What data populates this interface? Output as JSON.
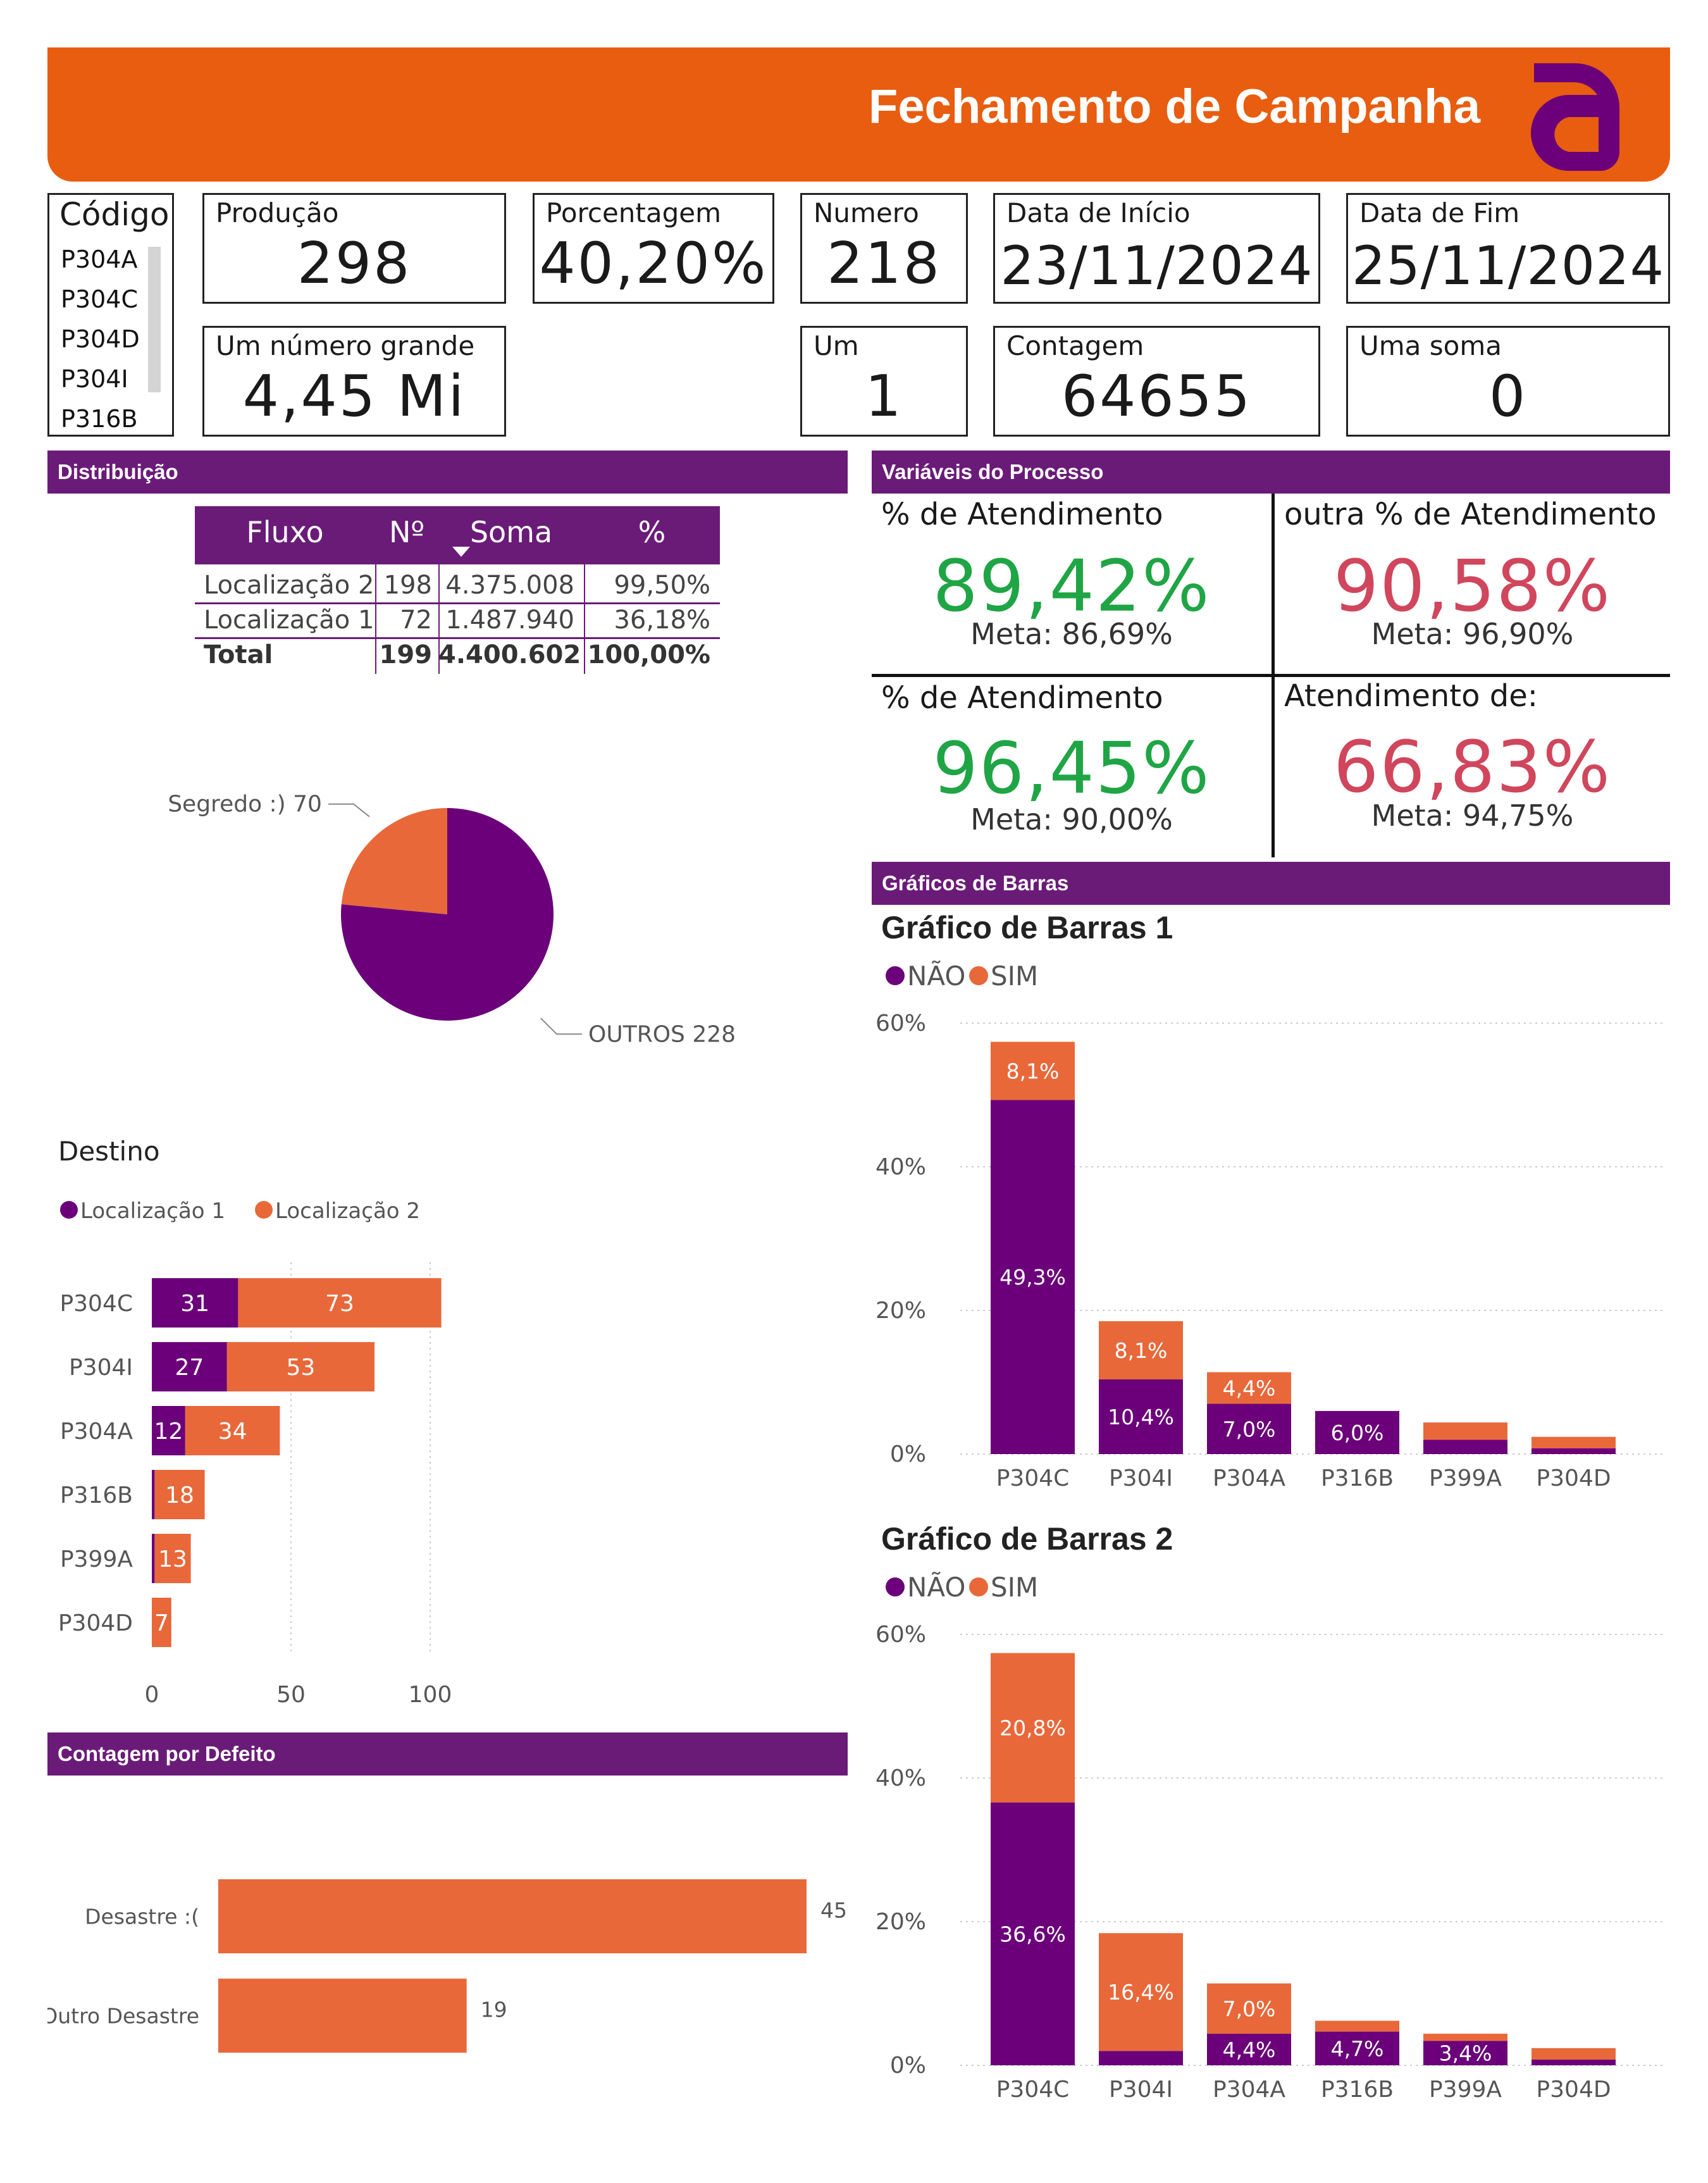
{
  "header": {
    "title": "Fechamento de Campanha"
  },
  "colors": {
    "purple": "#6b007a",
    "orange": "#e8683a",
    "header_orange": "#e85d10",
    "green": "#1fa545",
    "red": "#d0465c",
    "section": "#6a1b78"
  },
  "codigo": {
    "label": "Código",
    "items": [
      "P304A",
      "P304C",
      "P304D",
      "P304I",
      "P316B"
    ]
  },
  "cards": {
    "producao": {
      "label": "Produção",
      "value": "298"
    },
    "porcentagem": {
      "label": "Porcentagem",
      "value": "40,20%"
    },
    "numero": {
      "label": "Numero",
      "value": "218"
    },
    "data_inicio": {
      "label": "Data de Início",
      "value": "23/11/2024"
    },
    "data_fim": {
      "label": "Data de Fim",
      "value": "25/11/2024"
    },
    "numero_grande": {
      "label": "Um número grande",
      "value": "4,45 Mi"
    },
    "um": {
      "label": "Um",
      "value": "1"
    },
    "contagem": {
      "label": "Contagem",
      "value": "64655"
    },
    "soma": {
      "label": "Uma soma",
      "value": "0"
    }
  },
  "sections": {
    "distribuicao": "Distribuição",
    "variaveis": "Variáveis do Processo",
    "graficos": "Gráficos de Barras",
    "contagem_defeito": "Contagem por Defeito"
  },
  "table": {
    "headers": [
      "Fluxo",
      "Nº",
      "Soma",
      "%"
    ],
    "rows": [
      [
        "Localização 2",
        "198",
        "4.375.008",
        "99,50%"
      ],
      [
        "Localização 1",
        "72",
        "1.487.940",
        "36,18%"
      ]
    ],
    "total": [
      "Total",
      "199",
      "4.400.602",
      "100,00%"
    ]
  },
  "kpis": [
    {
      "label": "% de Atendimento",
      "value": "89,42%",
      "meta": "Meta: 86,69%",
      "status": "green"
    },
    {
      "label": "outra % de Atendimento",
      "value": "90,58%",
      "meta": "Meta: 96,90%",
      "status": "red"
    },
    {
      "label": "% de Atendimento",
      "value": "96,45%",
      "meta": "Meta: 90,00%",
      "status": "green"
    },
    {
      "label": "Atendimento de:",
      "value": "66,83%",
      "meta": "Meta: 94,75%",
      "status": "red"
    }
  ],
  "chart_data": [
    {
      "type": "pie",
      "title": "",
      "slices": [
        {
          "name": "OUTROS",
          "value": 228,
          "label": "OUTROS 228",
          "color": "#6b007a"
        },
        {
          "name": "Segredo :)",
          "value": 70,
          "label": "Segredo :) 70",
          "color": "#e8683a"
        }
      ]
    },
    {
      "type": "bar",
      "orientation": "horizontal",
      "stacked": true,
      "title": "Destino",
      "categories": [
        "P304C",
        "P304I",
        "P304A",
        "P316B",
        "P399A",
        "P304D"
      ],
      "series": [
        {
          "name": "Localização 1",
          "values": [
            31,
            27,
            12,
            1,
            1,
            0
          ],
          "labels": [
            "31",
            "27",
            "12",
            "",
            "",
            ""
          ],
          "color": "#6b007a"
        },
        {
          "name": "Localização 2",
          "values": [
            73,
            53,
            34,
            18,
            13,
            7
          ],
          "labels": [
            "73",
            "53",
            "34",
            "18",
            "13",
            "7"
          ],
          "color": "#e8683a"
        }
      ],
      "xticks": [
        "0",
        "50",
        "100"
      ],
      "xlim": [
        0,
        120
      ],
      "grid": true
    },
    {
      "type": "bar",
      "stacked": true,
      "title": "Gráfico de Barras 1",
      "categories": [
        "P304C",
        "P304I",
        "P304A",
        "P316B",
        "P399A",
        "P304D"
      ],
      "series": [
        {
          "name": "NÃO",
          "values": [
            49.3,
            10.4,
            7.0,
            6.0,
            2.0,
            0.8
          ],
          "labels": [
            "49,3%",
            "10,4%",
            "7,0%",
            "6,0%",
            "",
            ""
          ],
          "color": "#6b007a"
        },
        {
          "name": "SIM",
          "values": [
            8.1,
            8.1,
            4.4,
            0.0,
            2.4,
            1.6
          ],
          "labels": [
            "8,1%",
            "8,1%",
            "4,4%",
            "",
            "",
            ""
          ],
          "color": "#e8683a"
        }
      ],
      "yticks": [
        "0%",
        "20%",
        "40%",
        "60%"
      ],
      "ylim": [
        0,
        60
      ],
      "grid": true,
      "legend_position": "top-left"
    },
    {
      "type": "bar",
      "stacked": true,
      "title": "Gráfico de Barras 2",
      "categories": [
        "P304C",
        "P304I",
        "P304A",
        "P316B",
        "P399A",
        "P304D"
      ],
      "series": [
        {
          "name": "NÃO",
          "values": [
            36.6,
            2.0,
            4.4,
            4.7,
            3.4,
            0.8
          ],
          "labels": [
            "36,6%",
            "",
            "4,4%",
            "4,7%",
            "3,4%",
            ""
          ],
          "color": "#6b007a"
        },
        {
          "name": "SIM",
          "values": [
            20.8,
            16.4,
            7.0,
            1.5,
            1.0,
            1.6
          ],
          "labels": [
            "20,8%",
            "16,4%",
            "7,0%",
            "",
            "",
            ""
          ],
          "color": "#e8683a"
        }
      ],
      "yticks": [
        "0%",
        "20%",
        "40%",
        "60%"
      ],
      "ylim": [
        0,
        60
      ],
      "grid": true,
      "legend_position": "top-left"
    },
    {
      "type": "bar",
      "orientation": "horizontal",
      "title": "",
      "categories": [
        "Desastre :(",
        "Outro Desastre"
      ],
      "values": [
        45,
        19
      ],
      "color": "#e8683a"
    }
  ]
}
